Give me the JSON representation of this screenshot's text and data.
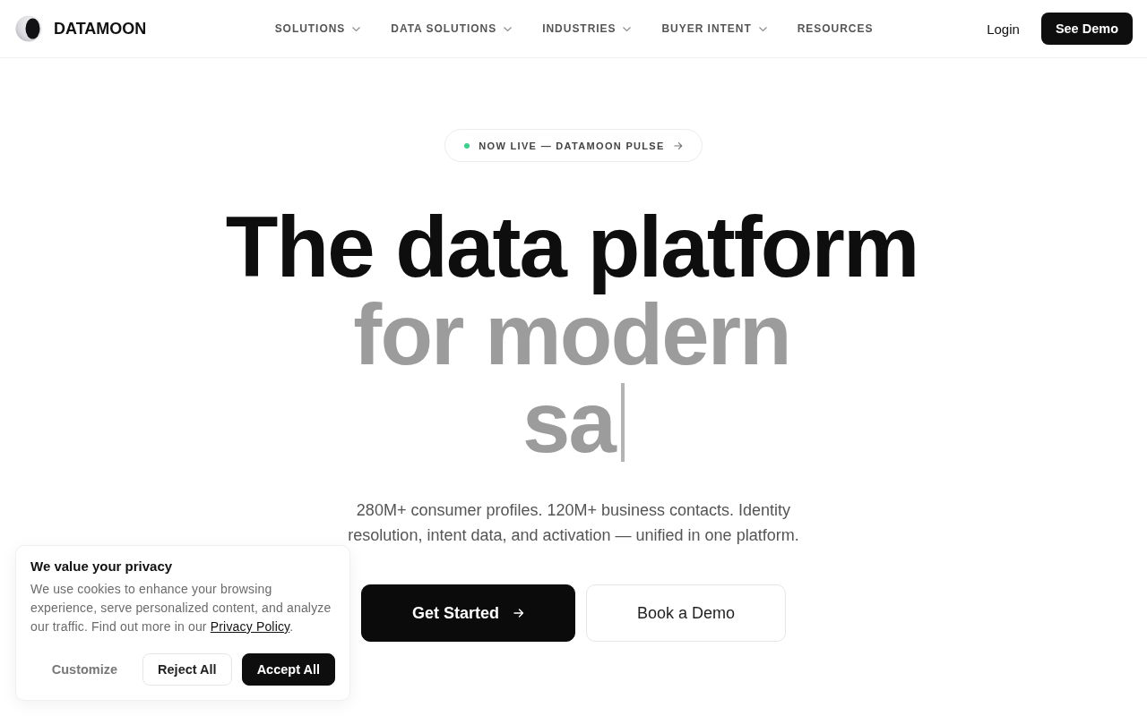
{
  "nav": {
    "brand": "DATAMOON",
    "items": [
      {
        "label": "SOLUTIONS",
        "has_menu": true
      },
      {
        "label": "DATA SOLUTIONS",
        "has_menu": true
      },
      {
        "label": "INDUSTRIES",
        "has_menu": true
      },
      {
        "label": "BUYER INTENT",
        "has_menu": true
      },
      {
        "label": "RESOURCES",
        "has_menu": false
      }
    ],
    "login": "Login",
    "cta": "See Demo"
  },
  "hero": {
    "badge": "NOW LIVE — DATAMOON PULSE",
    "headline": [
      {
        "text": "The data platform",
        "kind": "dark",
        "cursor": false
      },
      {
        "text": "for modern",
        "kind": "muted",
        "cursor": false
      },
      {
        "text": "sa",
        "kind": "muted",
        "cursor": true
      }
    ],
    "subtitle": "280M+ consumer profiles. 120M+ business contacts. Identity resolution, intent data, and activation — unified in one platform.",
    "buttons": [
      {
        "label": "Get Started",
        "kind": "primary"
      },
      {
        "label": "Book a Demo",
        "kind": "secondary"
      }
    ]
  },
  "cookie_banner": {
    "title": "We value your privacy",
    "text": "We use cookies to enhance your browsing experience, serve personalized content, and analyze our traffic. Find out more in our ",
    "link": "Privacy Policy",
    "text_end": ".",
    "buttons": [
      {
        "label": "Customize",
        "kind": "text"
      },
      {
        "label": "Reject All",
        "kind": "outline"
      },
      {
        "label": "Accept All",
        "kind": "solid"
      }
    ]
  }
}
